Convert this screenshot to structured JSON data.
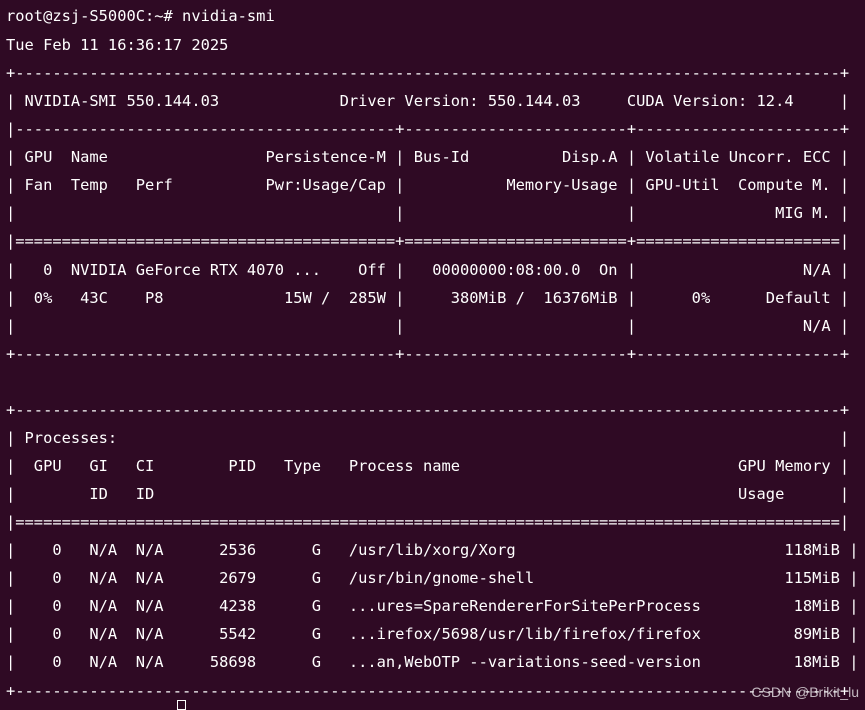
{
  "terminal": {
    "lines": [
      "root@zsj-S5000C:~# nvidia-smi",
      "Tue Feb 11 16:36:17 2025",
      "+-----------------------------------------------------------------------------------------+",
      "| NVIDIA-SMI 550.144.03             Driver Version: 550.144.03     CUDA Version: 12.4     |",
      "|-----------------------------------------+------------------------+----------------------+",
      "| GPU  Name                 Persistence-M | Bus-Id          Disp.A | Volatile Uncorr. ECC |",
      "| Fan  Temp   Perf          Pwr:Usage/Cap |           Memory-Usage | GPU-Util  Compute M. |",
      "|                                         |                        |               MIG M. |",
      "|=========================================+========================+======================|",
      "|   0  NVIDIA GeForce RTX 4070 ...    Off |   00000000:08:00.0  On |                  N/A |",
      "|  0%   43C    P8             15W /  285W |     380MiB /  16376MiB |      0%      Default |",
      "|                                         |                        |                  N/A |",
      "+-----------------------------------------+------------------------+----------------------+",
      "",
      "+-----------------------------------------------------------------------------------------+",
      "| Processes:                                                                              |",
      "|  GPU   GI   CI        PID   Type   Process name                              GPU Memory |",
      "|        ID   ID                                                               Usage      |",
      "|=========================================================================================|",
      "|    0   N/A  N/A      2536      G   /usr/lib/xorg/Xorg                             118MiB |",
      "|    0   N/A  N/A      2679      G   /usr/bin/gnome-shell                           115MiB |",
      "|    0   N/A  N/A      4238      G   ...ures=SpareRendererForSitePerProcess          18MiB |",
      "|    0   N/A  N/A      5542      G   ...irefox/5698/usr/lib/firefox/firefox          89MiB |",
      "|    0   N/A  N/A     58698      G   ...an,WebOTP --variations-seed-version          18MiB |",
      "+-----------------------------------------------------------------------------------------+"
    ],
    "watermark": "CSDN @Brikit_lu"
  },
  "colors": {
    "background": "#2f0a24",
    "foreground": "#ffffff"
  }
}
